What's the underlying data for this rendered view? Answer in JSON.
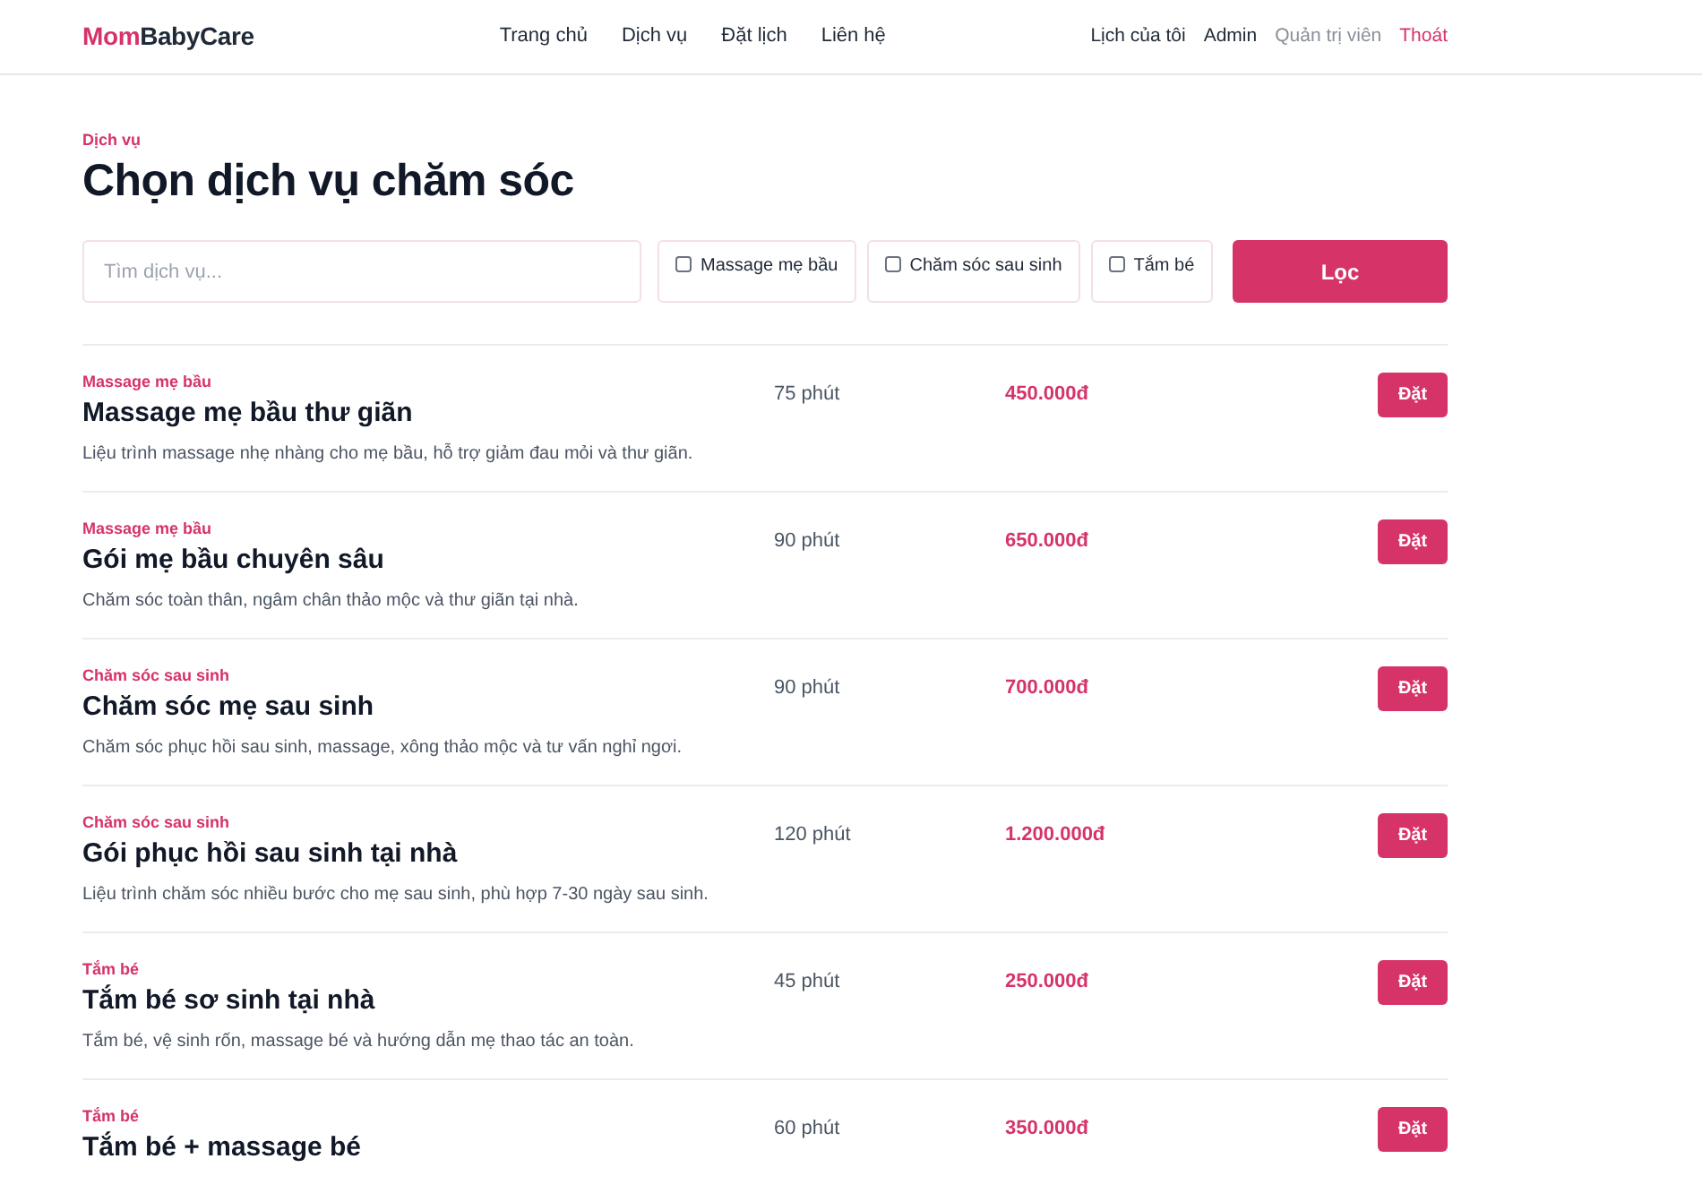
{
  "header": {
    "logo": {
      "accent": "Mom",
      "rest": "BabyCare"
    },
    "nav": [
      {
        "label": "Trang chủ"
      },
      {
        "label": "Dịch vụ"
      },
      {
        "label": "Đặt lịch"
      },
      {
        "label": "Liên hệ"
      }
    ],
    "user_nav": [
      {
        "label": "Lịch của tôi",
        "kind": "link"
      },
      {
        "label": "Admin",
        "kind": "user"
      },
      {
        "label": "Quản trị viên",
        "kind": "role"
      },
      {
        "label": "Thoát",
        "kind": "logout"
      }
    ]
  },
  "page": {
    "eyebrow": "Dịch vụ",
    "title": "Chọn dịch vụ chăm sóc"
  },
  "filters": {
    "search": {
      "placeholder": "Tìm dịch vụ..."
    },
    "categories": [
      {
        "label": "Massage mẹ bầu",
        "checked": false
      },
      {
        "label": "Chăm sóc sau sinh",
        "checked": false
      },
      {
        "label": "Tắm bé",
        "checked": false
      }
    ],
    "button": "Lọc"
  },
  "services": [
    {
      "category": "Massage mẹ bầu",
      "name": "Massage mẹ bầu thư giãn",
      "description": "Liệu trình massage nhẹ nhàng cho mẹ bầu, hỗ trợ giảm đau mỏi và thư giãn.",
      "duration": "75 phút",
      "price": "450.000đ",
      "button": "Đặt"
    },
    {
      "category": "Massage mẹ bầu",
      "name": "Gói mẹ bầu chuyên sâu",
      "description": "Chăm sóc toàn thân, ngâm chân thảo mộc và thư giãn tại nhà.",
      "duration": "90 phút",
      "price": "650.000đ",
      "button": "Đặt"
    },
    {
      "category": "Chăm sóc sau sinh",
      "name": "Chăm sóc mẹ sau sinh",
      "description": "Chăm sóc phục hồi sau sinh, massage, xông thảo mộc và tư vấn nghỉ ngơi.",
      "duration": "90 phút",
      "price": "700.000đ",
      "button": "Đặt"
    },
    {
      "category": "Chăm sóc sau sinh",
      "name": "Gói phục hồi sau sinh tại nhà",
      "description": "Liệu trình chăm sóc nhiều bước cho mẹ sau sinh, phù hợp 7-30 ngày sau sinh.",
      "duration": "120 phút",
      "price": "1.200.000đ",
      "button": "Đặt"
    },
    {
      "category": "Tắm bé",
      "name": "Tắm bé sơ sinh tại nhà",
      "description": "Tắm bé, vệ sinh rốn, massage bé và hướng dẫn mẹ thao tác an toàn.",
      "duration": "45 phút",
      "price": "250.000đ",
      "button": "Đặt"
    },
    {
      "category": "Tắm bé",
      "name": "Tắm bé + massage bé",
      "duration": "60 phút",
      "price": "350.000đ",
      "button": "Đặt"
    }
  ]
}
